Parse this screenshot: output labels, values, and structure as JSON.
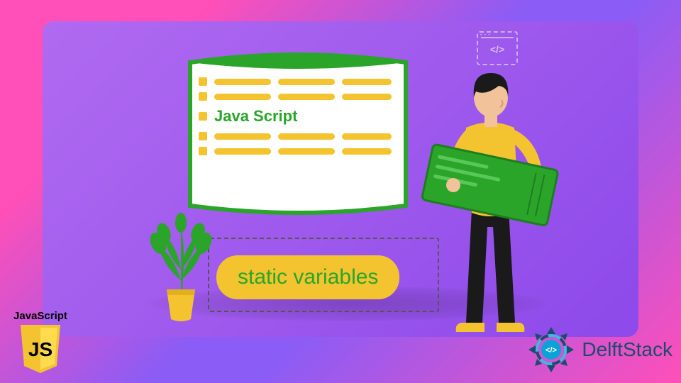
{
  "document_card": {
    "title_text": "Java Script"
  },
  "label_pill": "static variables",
  "codewin_symbol": "</>",
  "js_logo": {
    "label": "JavaScript",
    "monogram": "JS"
  },
  "brand": {
    "name": "DelftStack",
    "badge_symbol": "</>"
  },
  "colors": {
    "accent_yellow": "#f4c430",
    "accent_green": "#2aa52a",
    "purple_bg": "#8d49ea",
    "pink_edge": "#ff4fb8"
  }
}
